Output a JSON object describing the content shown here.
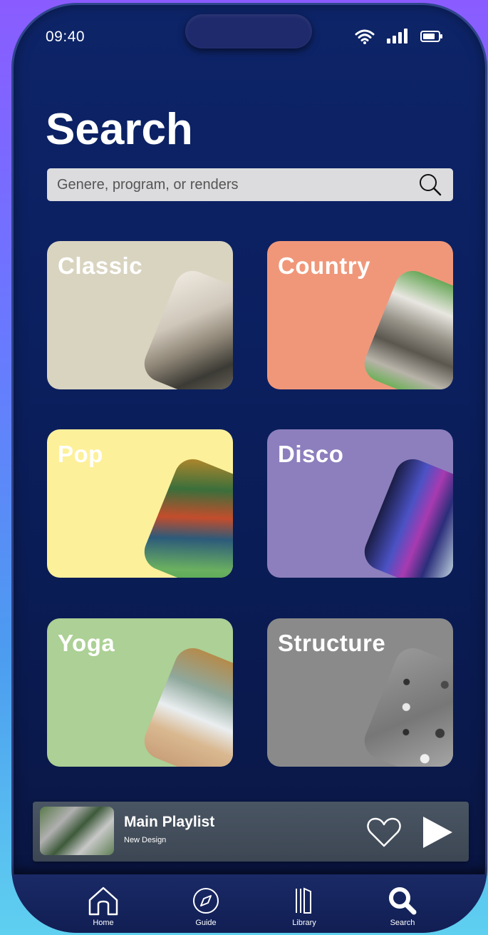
{
  "status_bar": {
    "time": "09:40"
  },
  "page": {
    "title": "Search"
  },
  "search": {
    "placeholder": "Genere, program, or renders"
  },
  "categories": [
    {
      "label": "Classic",
      "color": "#d9d4c0"
    },
    {
      "label": "Country",
      "color": "#f0977a"
    },
    {
      "label": "Pop",
      "color": "#fdf09a"
    },
    {
      "label": "Disco",
      "color": "#8d7fbd"
    },
    {
      "label": "Yoga",
      "color": "#acd095"
    },
    {
      "label": "Structure",
      "color": "#8a8a8a"
    }
  ],
  "now_playing": {
    "title": "Main Playlist",
    "subtitle": "New Design"
  },
  "tabs": [
    {
      "label": "Home",
      "icon": "home-icon"
    },
    {
      "label": "Guide",
      "icon": "compass-icon"
    },
    {
      "label": "Library",
      "icon": "library-icon"
    },
    {
      "label": "Search",
      "icon": "search-icon",
      "active": true
    }
  ]
}
